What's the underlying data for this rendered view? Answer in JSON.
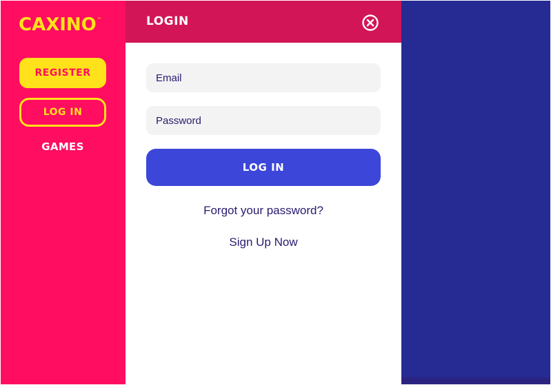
{
  "brand": {
    "logo_text": "CAXINO",
    "trademark": "™",
    "colors": {
      "primary_pink": "#ff0d61",
      "header_pink": "#d21556",
      "yellow": "#ffe21a",
      "button_blue": "#3c46d9",
      "backdrop_blue": "#252b92",
      "text_navy": "#2a1a6e"
    }
  },
  "sidebar": {
    "register_label": "REGISTER",
    "login_label": "LOG IN",
    "games_label": "GAMES"
  },
  "login_panel": {
    "title": "LOGIN",
    "close_icon": "close-circle-icon",
    "email_placeholder": "Email",
    "password_placeholder": "Password",
    "submit_label": "LOG IN",
    "forgot_password_label": "Forgot your password?",
    "sign_up_label": "Sign Up Now"
  }
}
